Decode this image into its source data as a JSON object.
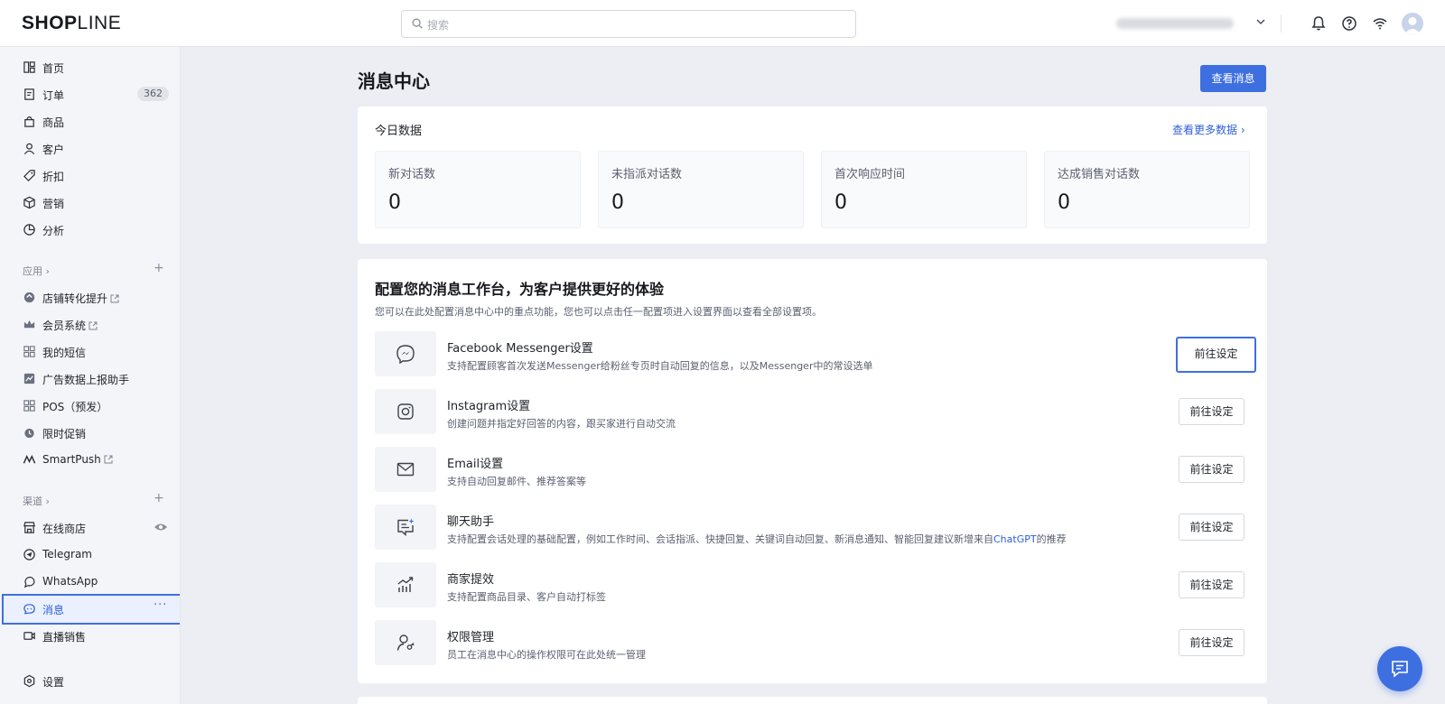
{
  "brand": {
    "logo_bold": "SH",
    "logo_o": "O",
    "logo_p": "P",
    "logo_thin": "LINE"
  },
  "header": {
    "search_placeholder": "搜索"
  },
  "sidebar": {
    "items": [
      {
        "label": "首页",
        "icon": "layout-icon"
      },
      {
        "label": "订单",
        "icon": "order-icon",
        "badge": "362"
      },
      {
        "label": "商品",
        "icon": "bag-icon"
      },
      {
        "label": "客户",
        "icon": "user-icon"
      },
      {
        "label": "折扣",
        "icon": "tag-icon"
      },
      {
        "label": "营销",
        "icon": "cube-icon"
      },
      {
        "label": "分析",
        "icon": "pie-icon"
      }
    ],
    "apps_section": "应用",
    "apps": [
      {
        "label": "店铺转化提升",
        "external": true
      },
      {
        "label": "会员系统",
        "external": true
      },
      {
        "label": "我的短信"
      },
      {
        "label": "广告数据上报助手"
      },
      {
        "label": "POS（预发）"
      },
      {
        "label": "限时促销"
      },
      {
        "label": "SmartPush",
        "external": true
      }
    ],
    "channels_section": "渠道",
    "channels": [
      {
        "label": "在线商店"
      },
      {
        "label": "Telegram"
      },
      {
        "label": "WhatsApp"
      },
      {
        "label": "消息",
        "active": true
      },
      {
        "label": "直播销售"
      }
    ],
    "settings": "设置"
  },
  "main": {
    "title": "消息中心",
    "view_button": "查看消息",
    "today": {
      "title": "今日数据",
      "more_link": "查看更多数据",
      "stats": [
        {
          "label": "新对话数",
          "value": "0"
        },
        {
          "label": "未指派对话数",
          "value": "0"
        },
        {
          "label": "首次响应时间",
          "value": "0"
        },
        {
          "label": "达成销售对话数",
          "value": "0"
        }
      ]
    },
    "config": {
      "headline": "配置您的消息工作台，为客户提供更好的体验",
      "subline": "您可以在此处配置消息中心中的重点功能，您也可以点击任一配置项进入设置界面以查看全部设置项。",
      "items": [
        {
          "title": "Facebook Messenger设置",
          "desc": "支持配置顾客首次发送Messenger给粉丝专页时自动回复的信息，以及Messenger中的常设选单",
          "button": "前往设定",
          "icon": "messenger-icon"
        },
        {
          "title": "Instagram设置",
          "desc": "创建问题并指定好回答的内容，跟买家进行自动交流",
          "button": "前往设定",
          "icon": "instagram-icon"
        },
        {
          "title": "Email设置",
          "desc": "支持自动回复邮件、推荐答案等",
          "button": "前往设定",
          "icon": "email-icon"
        },
        {
          "title": "聊天助手",
          "desc": "支持配置会话处理的基础配置，例如工作时间、会话指派、快捷回复、关键词自动回复、新消息通知、智能回复建议新增来自",
          "desc_link": "ChatGPT",
          "desc_tail": "的推荐",
          "button": "前往设定",
          "icon": "chat-assistant-icon"
        },
        {
          "title": "商家提效",
          "desc": "支持配置商品目录、客户自动打标签",
          "button": "前往设定",
          "icon": "chart-up-icon"
        },
        {
          "title": "权限管理",
          "desc": "员工在消息中心的操作权限可在此处统一管理",
          "button": "前往设定",
          "icon": "user-key-icon"
        }
      ]
    }
  },
  "colors": {
    "accent": "#3e6fe1",
    "link": "#2f5fd8",
    "bg": "#eceef3"
  }
}
